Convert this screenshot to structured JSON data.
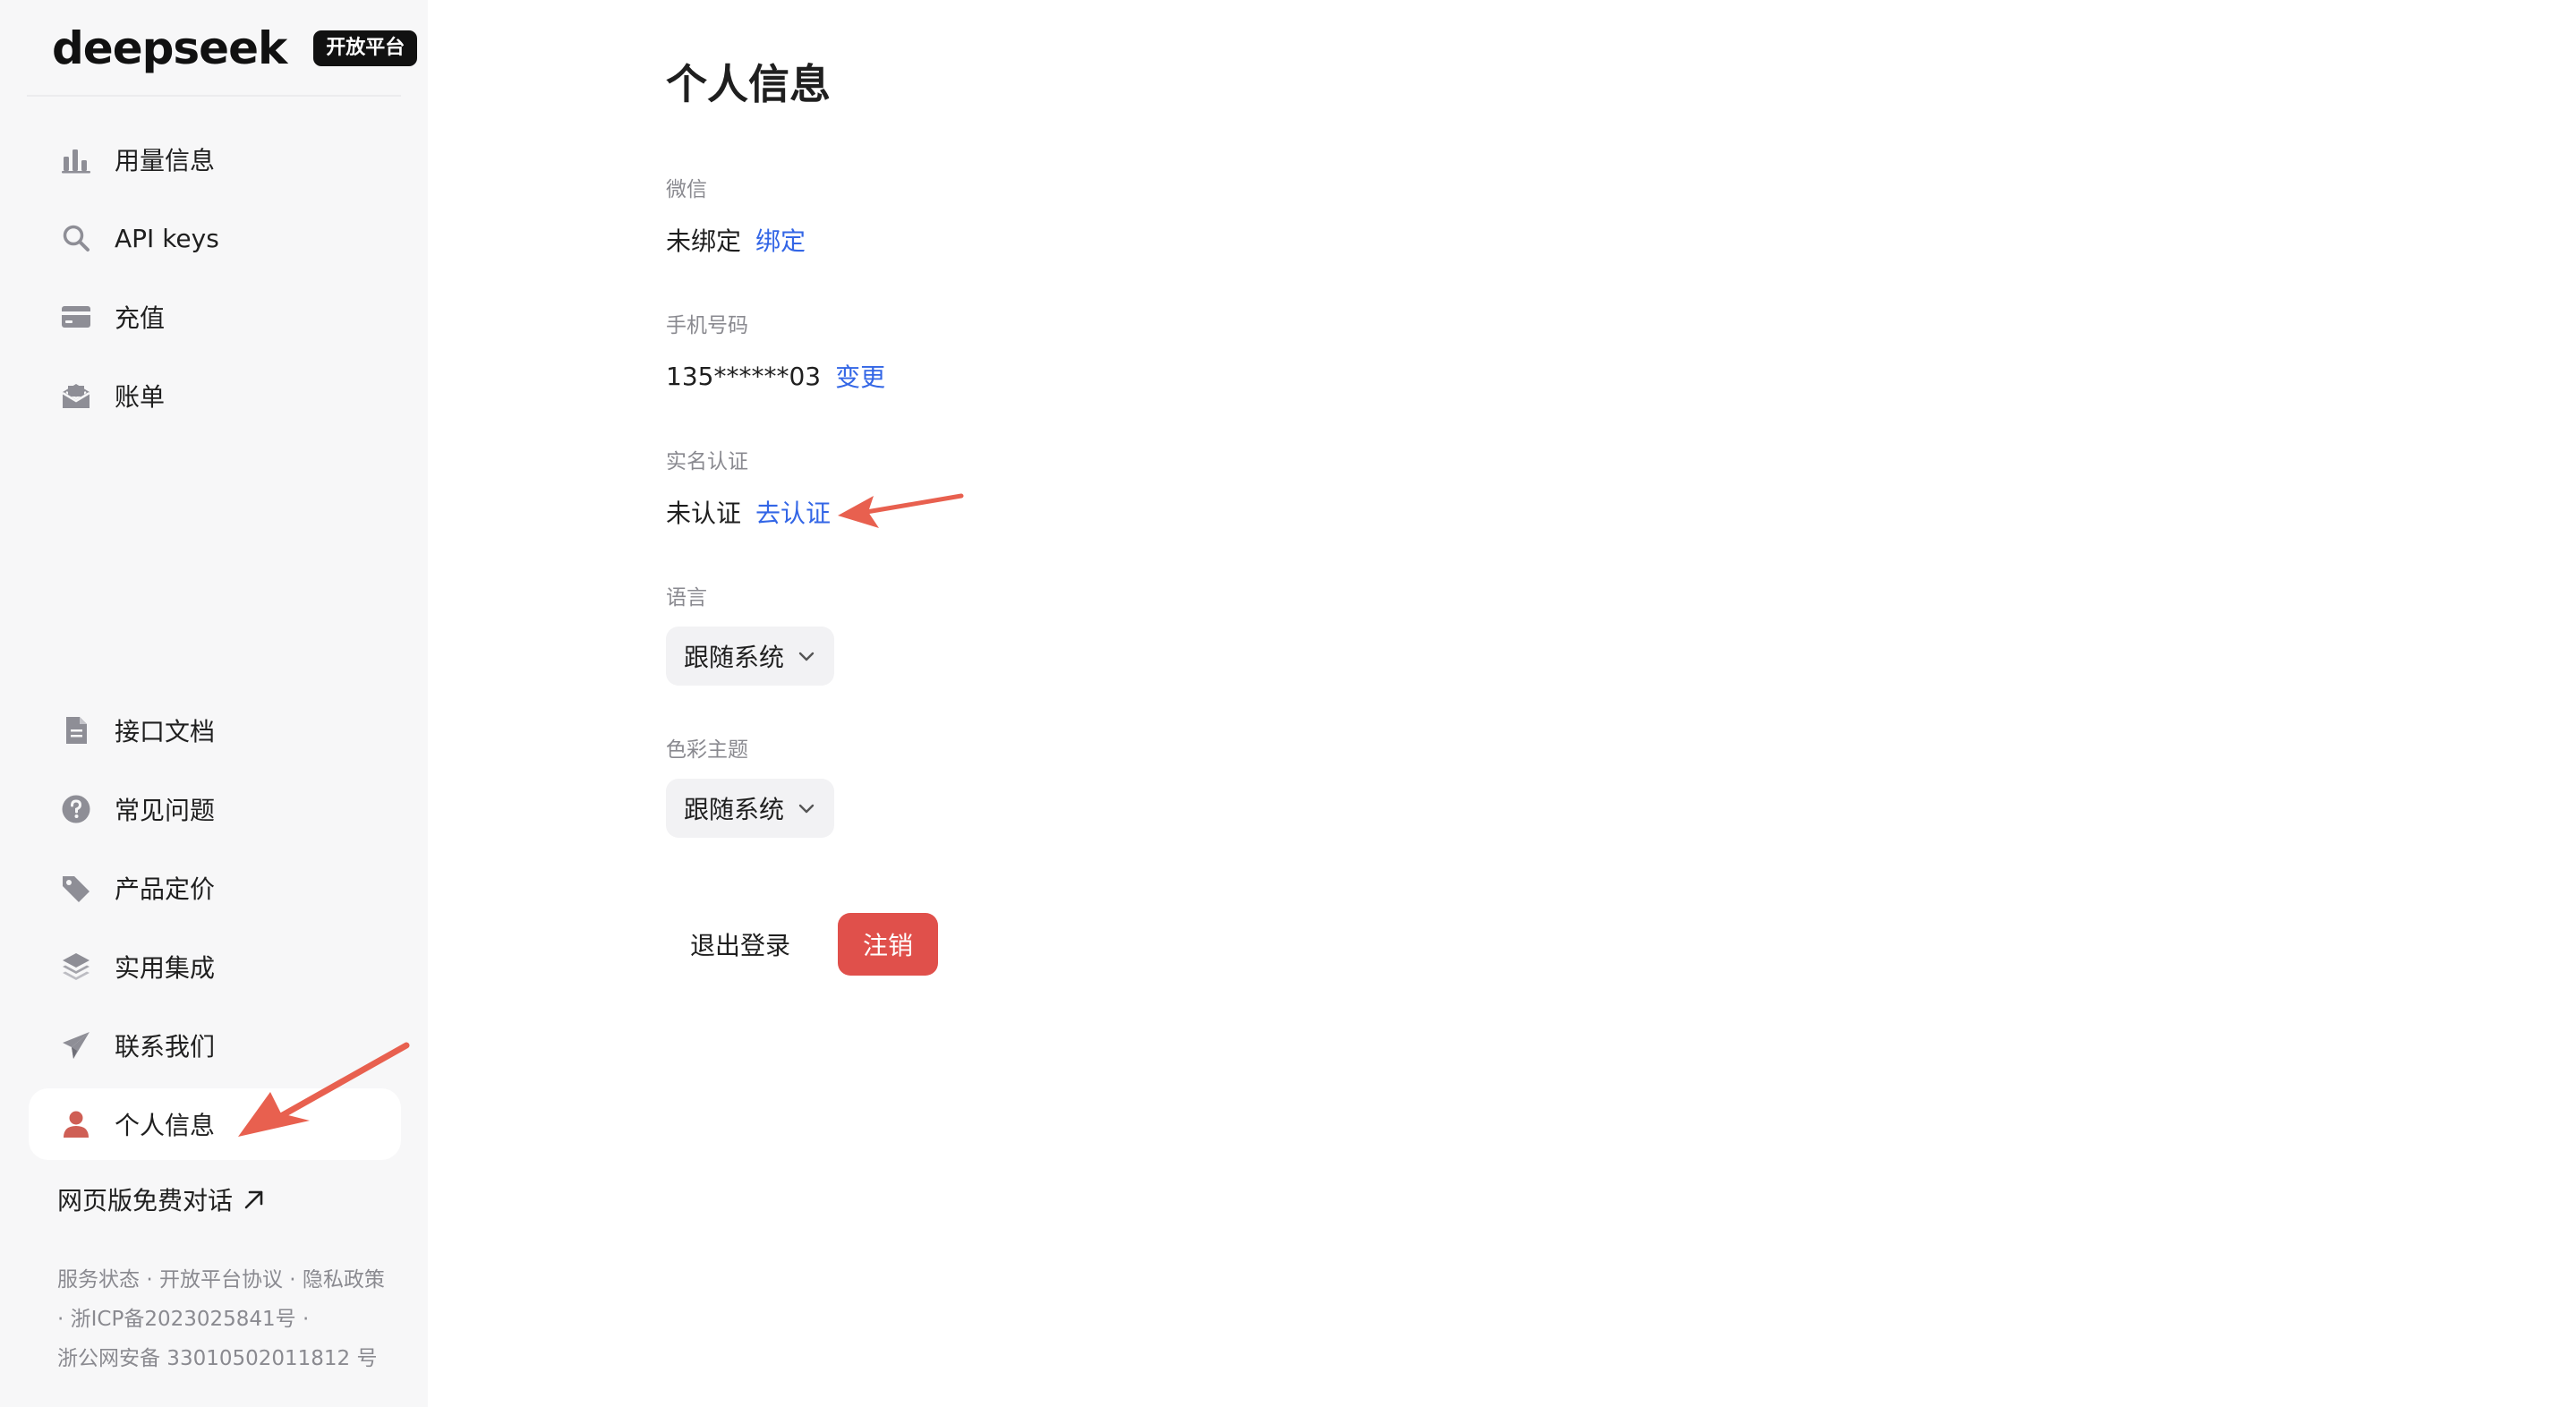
{
  "brand": {
    "logo_text": "deepseek",
    "badge": "开放平台"
  },
  "sidebar": {
    "top_items": [
      {
        "label": "用量信息",
        "icon": "bar-chart-icon"
      },
      {
        "label": "API keys",
        "icon": "search-icon"
      },
      {
        "label": "充值",
        "icon": "wallet-icon"
      },
      {
        "label": "账单",
        "icon": "receipt-icon"
      }
    ],
    "bottom_items": [
      {
        "label": "接口文档",
        "icon": "document-icon"
      },
      {
        "label": "常见问题",
        "icon": "question-icon"
      },
      {
        "label": "产品定价",
        "icon": "price-tag-icon"
      },
      {
        "label": "实用集成",
        "icon": "layers-icon"
      },
      {
        "label": "联系我们",
        "icon": "paper-plane-icon"
      },
      {
        "label": "个人信息",
        "icon": "user-icon",
        "active": true
      }
    ],
    "web_chat": "网页版免费对话",
    "footer": {
      "service_status": "服务状态",
      "agreement": "开放平台协议",
      "privacy": "隐私政策",
      "icp": "浙ICP备2023025841号",
      "police": "浙公网安备 33010502011812 号"
    }
  },
  "main": {
    "title": "个人信息",
    "wechat": {
      "label": "微信",
      "value": "未绑定",
      "action": "绑定"
    },
    "phone": {
      "label": "手机号码",
      "value": "135******03",
      "action": "变更"
    },
    "realname": {
      "label": "实名认证",
      "value": "未认证",
      "action": "去认证"
    },
    "language": {
      "label": "语言",
      "selected": "跟随系统"
    },
    "theme": {
      "label": "色彩主题",
      "selected": "跟随系统"
    },
    "logout": "退出登录",
    "delete_account": "注销"
  },
  "colors": {
    "link": "#3366e6",
    "danger": "#e0504b",
    "annotation": "#e8604f",
    "sidebar_bg": "#f7f7f8"
  }
}
